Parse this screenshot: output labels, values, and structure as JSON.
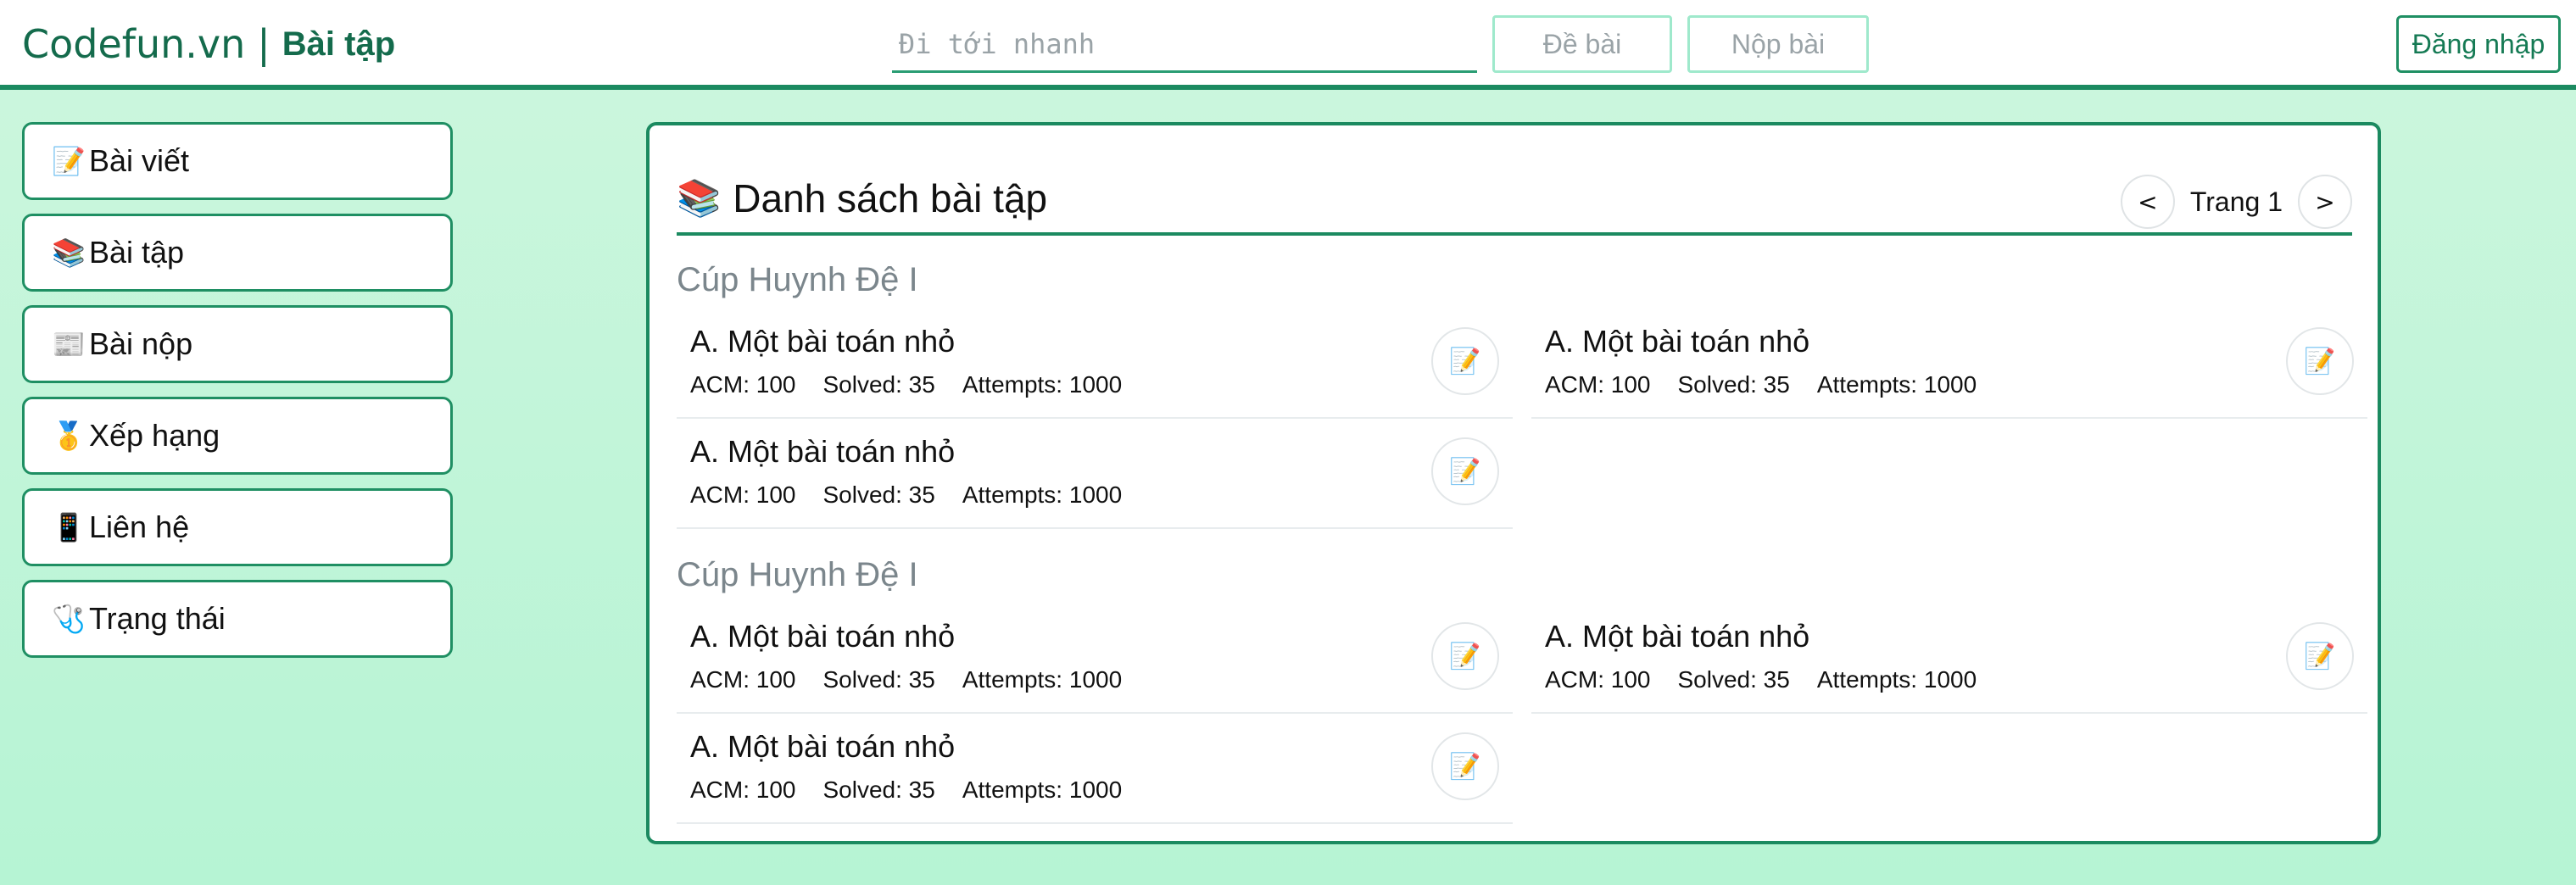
{
  "header": {
    "site": "Codefun.vn",
    "separator": "|",
    "page": "Bài tập",
    "search_placeholder": "Đi tới nhanh",
    "buttons": {
      "problem": "Đề bài",
      "submit": "Nộp bài",
      "login": "Đăng nhập"
    }
  },
  "sidebar": {
    "items": [
      {
        "icon": "📝",
        "icon_name": "memo-icon",
        "label": "Bài viết"
      },
      {
        "icon": "📚",
        "icon_name": "books-icon",
        "label": "Bài tập"
      },
      {
        "icon": "📰",
        "icon_name": "newspaper-icon",
        "label": "Bài nộp"
      },
      {
        "icon": "🥇",
        "icon_name": "medal-icon",
        "label": "Xếp hạng"
      },
      {
        "icon": "📱",
        "icon_name": "phone-icon",
        "label": "Liên hệ"
      },
      {
        "icon": "🩺",
        "icon_name": "stethoscope-icon",
        "label": "Trạng thái"
      }
    ]
  },
  "main": {
    "title_icon": "📚",
    "title": "Danh sách bài tập",
    "pager": {
      "prev": "<",
      "label": "Trang 1",
      "next": ">"
    },
    "sections": [
      {
        "title": "Cúp Huynh Đệ I",
        "problems": [
          {
            "name": "A. Một bài toán nhỏ",
            "acm": "ACM: 100",
            "solved": "Solved: 35",
            "attempts": "Attempts: 1000",
            "icon": "📝"
          },
          {
            "name": "A. Một bài toán nhỏ",
            "acm": "ACM: 100",
            "solved": "Solved: 35",
            "attempts": "Attempts: 1000",
            "icon": "📝"
          },
          {
            "name": "A. Một bài toán nhỏ",
            "acm": "ACM: 100",
            "solved": "Solved: 35",
            "attempts": "Attempts: 1000",
            "icon": "📝"
          }
        ]
      },
      {
        "title": "Cúp Huynh Đệ I",
        "problems": [
          {
            "name": "A. Một bài toán nhỏ",
            "acm": "ACM: 100",
            "solved": "Solved: 35",
            "attempts": "Attempts: 1000",
            "icon": "📝"
          },
          {
            "name": "A. Một bài toán nhỏ",
            "acm": "ACM: 100",
            "solved": "Solved: 35",
            "attempts": "Attempts: 1000",
            "icon": "📝"
          },
          {
            "name": "A. Một bài toán nhỏ",
            "acm": "ACM: 100",
            "solved": "Solved: 35",
            "attempts": "Attempts: 1000",
            "icon": "📝"
          }
        ]
      }
    ]
  },
  "colors": {
    "accent": "#1b8a60",
    "brand_text": "#146b4c",
    "background_top": "#cdf6de",
    "background_bottom": "#b6f4d4",
    "muted": "#9aa3a7"
  }
}
